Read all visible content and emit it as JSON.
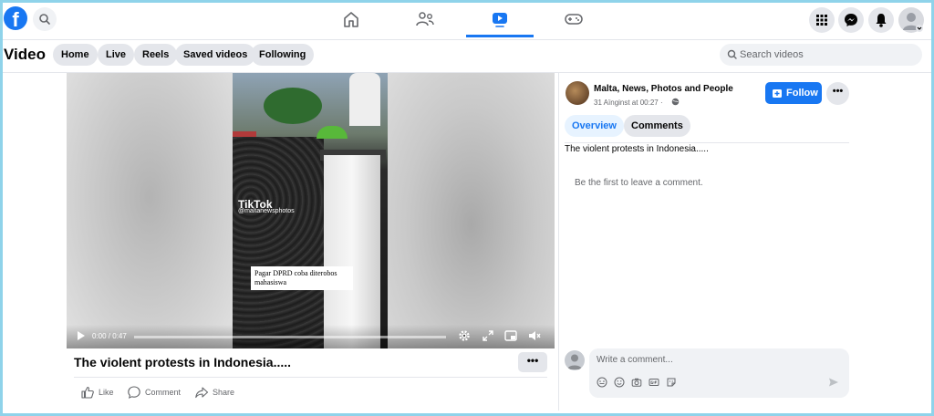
{
  "nav": {
    "logo_glyph": "f",
    "search_label": "Search Facebook"
  },
  "subheader": {
    "title": "Video",
    "pills": [
      "Home",
      "Live",
      "Reels",
      "Saved videos",
      "Following"
    ],
    "search_placeholder": "Search videos"
  },
  "video": {
    "tiktok_logo": "TikTok",
    "tiktok_handle": "@maltanewsphotos",
    "caption": "Pagar DPRD coba diterobos mahasiswa",
    "time": "0:00 / 0:47",
    "progress": 0
  },
  "post": {
    "title": "The violent protests in Indonesia.....",
    "more": "•••",
    "actions": [
      "Like",
      "Comment",
      "Share"
    ]
  },
  "page": {
    "name": "Malta, News, Photos and People",
    "meta": "31 Aïnginst at 00:27 ·",
    "follow_label": "Follow",
    "more": "•••"
  },
  "tabs": [
    "Overview",
    "Comments"
  ],
  "description": "The violent protests in Indonesia.....",
  "first_comment": "Be the first to leave a comment.",
  "comment": {
    "placeholder": "Write a comment..."
  },
  "colors": {
    "accent": "#1877f2",
    "frame": "#8fd3ea",
    "pill_bg": "#e4e6eb"
  }
}
